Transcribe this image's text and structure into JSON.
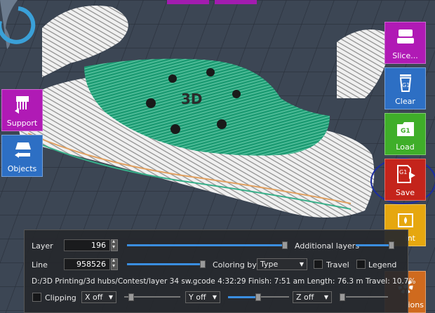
{
  "toolbar_right": {
    "slice": {
      "label": "Slice...",
      "color": "#b01ab5"
    },
    "clear": {
      "label": "Clear",
      "color": "#2d6fc4"
    },
    "load": {
      "label": "Load",
      "color": "#3fae29"
    },
    "save": {
      "label": "Save",
      "color": "#c4241b"
    },
    "print": {
      "label": "int",
      "color": "#e6a70f"
    },
    "options": {
      "label": "ions",
      "color": "#cf6a1e"
    }
  },
  "toolbar_left": {
    "support": {
      "label": "Support",
      "color": "#b01ab5"
    },
    "objects": {
      "label": "Objects",
      "color": "#2d6fc4"
    }
  },
  "model": {
    "text": "3D"
  },
  "panel": {
    "layer_label": "Layer",
    "layer_value": "196",
    "additional_layers_label": "Additional layers",
    "line_label": "Line",
    "line_value": "958526",
    "coloring_by_label": "Coloring by",
    "coloring_value": "Type",
    "travel_label": "Travel",
    "legend_label": "Legend",
    "info": "D:/3D Printing/3d hubs/Contest/layer 34 sw.gcode  4:32:29  Finish: 7:51 am  Length: 76.3 m  Travel: 10.7%",
    "clipping_label": "Clipping",
    "x_value": "X off",
    "y_value": "Y off",
    "z_value": "Z off"
  }
}
